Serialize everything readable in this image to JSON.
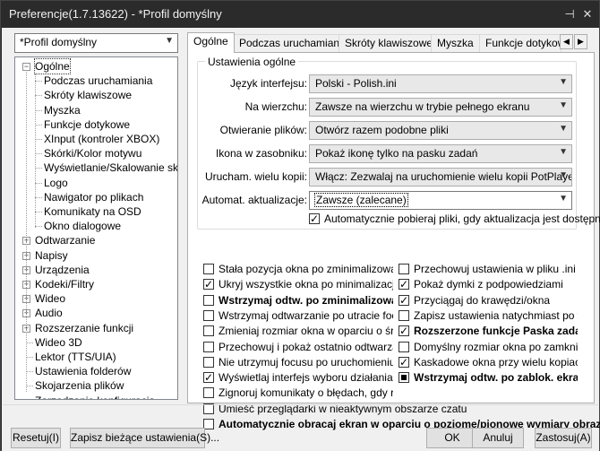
{
  "window": {
    "title": "Preferencje(1.7.13622) - *Profil domyślny",
    "pin_icon": "pin-icon",
    "close_icon": "close-icon"
  },
  "profile": {
    "selected": "*Profil domyślny"
  },
  "tree": [
    {
      "label": "Ogólne",
      "level": 0,
      "expander": "−",
      "selected": true
    },
    {
      "label": "Podczas uruchamiania",
      "level": 1
    },
    {
      "label": "Skróty klawiszowe",
      "level": 1
    },
    {
      "label": "Myszka",
      "level": 1
    },
    {
      "label": "Funkcje dotykowe",
      "level": 1
    },
    {
      "label": "XInput (kontroler XBOX)",
      "level": 1
    },
    {
      "label": "Skórki/Kolor motywu",
      "level": 1
    },
    {
      "label": "Wyświetlanie/Skalowanie sk",
      "level": 1
    },
    {
      "label": "Logo",
      "level": 1
    },
    {
      "label": "Nawigator po plikach",
      "level": 1
    },
    {
      "label": "Komunikaty na OSD",
      "level": 1
    },
    {
      "label": "Okno dialogowe",
      "level": 1
    },
    {
      "label": "Odtwarzanie",
      "level": 0,
      "expander": "+"
    },
    {
      "label": "Napisy",
      "level": 0,
      "expander": "+"
    },
    {
      "label": "Urządzenia",
      "level": 0,
      "expander": "+"
    },
    {
      "label": "Kodeki/Filtry",
      "level": 0,
      "expander": "+"
    },
    {
      "label": "Wideo",
      "level": 0,
      "expander": "+"
    },
    {
      "label": "Audio",
      "level": 0,
      "expander": "+"
    },
    {
      "label": "Rozszerzanie funkcji",
      "level": 0,
      "expander": "+"
    },
    {
      "label": "Wideo 3D",
      "level": 0
    },
    {
      "label": "Lektor (TTS/UIA)",
      "level": 0
    },
    {
      "label": "Ustawienia folderów",
      "level": 0
    },
    {
      "label": "Skojarzenia plików",
      "level": 0
    },
    {
      "label": "Zarzadzanie konfiguracja",
      "level": 0
    }
  ],
  "tabs": [
    {
      "label": "Ogólne",
      "active": true
    },
    {
      "label": "Podczas uruchamiania"
    },
    {
      "label": "Skróty klawiszowe"
    },
    {
      "label": "Myszka"
    },
    {
      "label": "Funkcje dotykowe"
    }
  ],
  "tab_scroll": {
    "left": "◀",
    "right": "▶"
  },
  "general": {
    "group_title": "Ustawienia ogólne",
    "rows": [
      {
        "label": "Język interfejsu:",
        "value": "Polski - Polish.ini"
      },
      {
        "label": "Na wierzchu:",
        "value": "Zawsze na wierzchu w trybie pełnego ekranu"
      },
      {
        "label": "Otwieranie plików:",
        "value": "Otwórz razem podobne pliki"
      },
      {
        "label": "Ikona w zasobniku:",
        "value": "Pokaż ikonę tylko na pasku zadań"
      },
      {
        "label": "Urucham. wielu kopii:",
        "value": "Włącz: Zezwalaj na uruchomienie wielu kopii PotPlayer"
      },
      {
        "label": "Automat. aktualizacje:",
        "value": "Zawsze (zalecane)",
        "focused": true
      }
    ],
    "auto_download": {
      "label": "Automatycznie pobieraj pliki, gdy aktualizacja jest dostępna",
      "checked": true
    }
  },
  "options_left": [
    {
      "label": "Stała pozycja okna po zminimalizowaniu",
      "checked": false
    },
    {
      "label": "Ukryj wszystkie okna po minimalizacji",
      "checked": true
    },
    {
      "label": "Wstrzymaj odtw. po zminimalizowaniu",
      "checked": false,
      "bold": true
    },
    {
      "label": "Wstrzymaj odtwarzanie po utracie focusu",
      "checked": false
    },
    {
      "label": "Zmieniaj rozmiar okna w oparciu o środek",
      "checked": false
    },
    {
      "label": "Przechowuj i pokaż ostatnio odtwarzane ...",
      "checked": false
    },
    {
      "label": "Nie utrzymuj focusu po uruchomieniu z ...",
      "checked": false
    },
    {
      "label": "Wyświetlaj interfejs wyboru działania prz...",
      "checked": true
    },
    {
      "label": "Zignoruj komunikaty o błędach, gdy roz...",
      "checked": false
    },
    {
      "label": "Umieść przeglądarki w nieaktywnym obszarze czatu",
      "checked": false
    },
    {
      "label": "Automatycznie obracaj ekran w oparciu o poziome/pionowe wymiary obrazu",
      "checked": false,
      "bold": true
    }
  ],
  "options_right": [
    {
      "label": "Przechowuj ustawienia w pliku .ini",
      "checked": false
    },
    {
      "label": "Pokaż dymki z podpowiedziami",
      "checked": true
    },
    {
      "label": "Przyciągaj do krawędzi/okna",
      "checked": true
    },
    {
      "label": "Zapisz ustawienia natychmiast po w...",
      "checked": false
    },
    {
      "label": "Rozszerzone funkcje Paska zadań",
      "checked": true,
      "bold": true
    },
    {
      "label": "Domyślny rozmiar okna po zamknię...",
      "checked": false
    },
    {
      "label": "Kaskadowe okna przy wielu kopiach",
      "checked": true
    },
    {
      "label": "Wstrzymaj odtw. po zablok. ekranu",
      "checked": "square",
      "bold": true
    }
  ],
  "buttons": {
    "reset": "Resetuj(I)",
    "save_current": "Zapisz bieżące ustawienia(S)...",
    "ok": "OK",
    "cancel": "Anuluj",
    "apply": "Zastosuj(A)"
  }
}
